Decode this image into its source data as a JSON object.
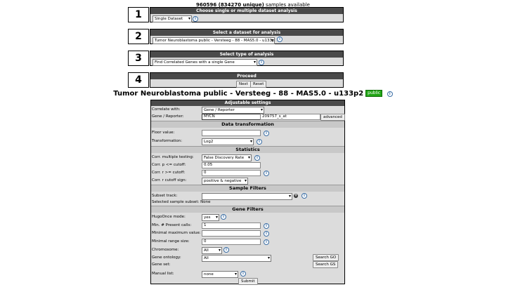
{
  "header": {
    "count_bold": "960596 (834270 unique)",
    "count_suffix": " samples available"
  },
  "steps": [
    {
      "number": "1",
      "title": "Choose single or multiple dataset analysis",
      "select": "Single Dataset"
    },
    {
      "number": "2",
      "title": "Select a dataset for analysis",
      "select": "Tumor Neuroblastoma public - Versteeg - 88 - MAS5.0 - u133p2"
    },
    {
      "number": "3",
      "title": "Select type of analysis",
      "select": "Find Correlated Genes with a single Gene"
    },
    {
      "number": "4",
      "title": "Proceed",
      "next": "Next",
      "reset": "Reset"
    }
  ],
  "dataset": {
    "title": "Tumor Neuroblastoma public - Versteeg - 88 - MAS5.0 - u133p2",
    "badge": "public"
  },
  "settings": {
    "title": "Adjustable settings",
    "correlate_with_label": "Correlate with:",
    "correlate_with_value": "Gene / Reporter",
    "gene_label": "Gene / Reporter:",
    "gene_value": "MYCN",
    "reporter_value": "209757_s_at",
    "advanced": "advanced",
    "data_transformation": "Data transformation",
    "floor_label": "Floor value:",
    "floor_value": "",
    "transformation_label": "Transformation:",
    "transformation_value": "Log2",
    "statistics": "Statistics",
    "multiple_label": "Corr. multiple testing:",
    "multiple_value": "False Discovery Rate",
    "p_label": "Corr. p <= cutoff:",
    "p_value": "0.05",
    "r_label": "Corr. r >= cutoff:",
    "r_value": "0",
    "sign_label": "Corr. r cutoff sign:",
    "sign_value": "positive & negative",
    "sample_filters": "Sample Filters",
    "subset_label": "Subset track:",
    "subset_value": "",
    "selected_subset": "Selected sample subset: None",
    "gene_filters": "Gene Filters",
    "hugo_label": "HugoOnce mode:",
    "hugo_value": "yes",
    "present_label": "Min. # Present calls:",
    "present_value": "1",
    "minmax_label": "Minimal maximum value:",
    "minmax_value": "",
    "range_label": "Minimal range size:",
    "range_value": "0",
    "chrom_label": "Chromosome:",
    "chrom_value": "All",
    "ontology_label": "Gene ontology:",
    "ontology_value": "All",
    "geneset_label": "Gene set:",
    "search_go": "Search GO",
    "search_gs": "Search GS",
    "manual_label": "Manual list:",
    "manual_value": "none",
    "submit": "Submit"
  }
}
